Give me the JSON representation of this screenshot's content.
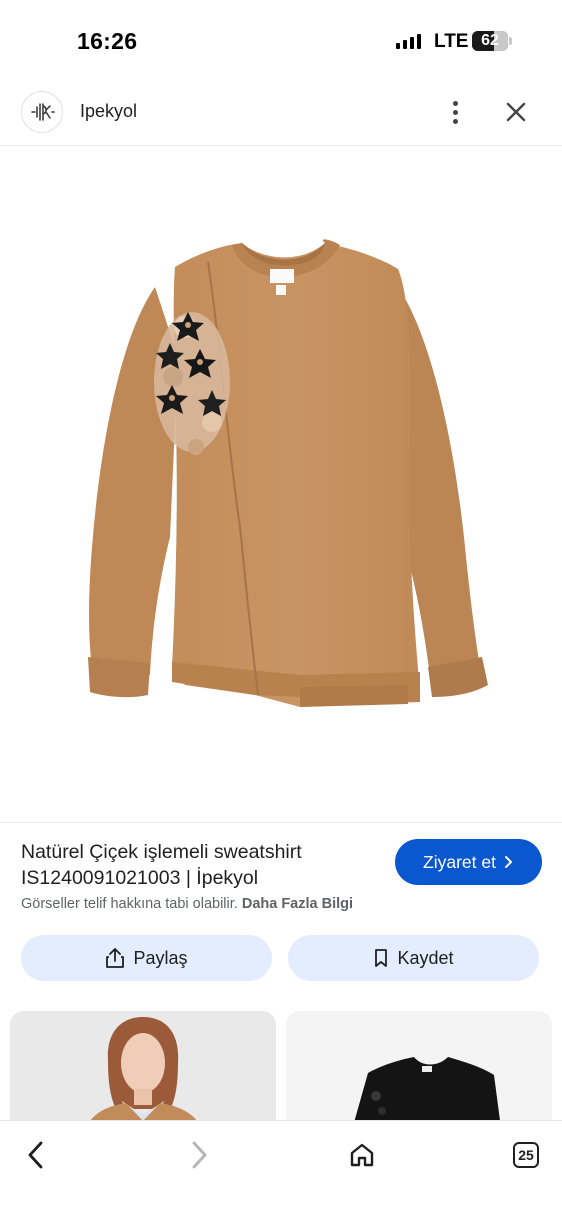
{
  "status_bar": {
    "time": "16:26",
    "network": "LTE",
    "battery": "62",
    "battery_level_percent": 62
  },
  "header": {
    "site_name": "Ipekyol",
    "logo_icon": "ipekyol-logo-icon",
    "more_icon": "more-vert-icon",
    "close_icon": "close-icon"
  },
  "product": {
    "title": "Natürel Çiçek işlemeli sweatshirt IS1240091021003 | İpekyol",
    "copyright_text": "Görseller telif hakkına tabi olabilir.",
    "more_info_link": "Daha Fazla Bilgi",
    "visit_label": "Ziyaret et",
    "colors": {
      "sweatshirt": "#c48f5e",
      "accent_blue": "#0b57d0",
      "pill_bg": "#e4edfd"
    }
  },
  "actions": {
    "share_label": "Paylaş",
    "save_label": "Kaydet"
  },
  "bottom_nav": {
    "back_icon": "chevron-left-icon",
    "forward_icon": "chevron-right-icon",
    "home_icon": "home-icon",
    "tabs_count": "25"
  }
}
